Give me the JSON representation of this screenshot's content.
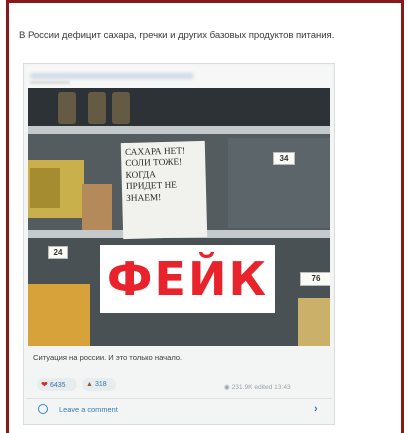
{
  "article": {
    "headline": "В России дефицит сахара, гречки и других базовых продуктов питания."
  },
  "post": {
    "sign_lines": [
      "САХАРА НЕТ!",
      "СОЛИ ТОЖЕ!",
      "КОГДА",
      "ПРИДЕТ НЕ",
      "ЗНАЕМ!"
    ],
    "price_tags": [
      "34",
      "24",
      "76"
    ],
    "stamp": "ФЕЙК",
    "caption": "Ситуация на россии. И это только начало.",
    "reactions": [
      {
        "icon": "heart-icon",
        "count": "6435"
      },
      {
        "icon": "poop-emoji-icon",
        "count": "318"
      }
    ],
    "views": "231.9K",
    "edited": "edited 13:43",
    "comment_label": "Leave a comment"
  },
  "colors": {
    "frame_border": "#8a1a1a",
    "stamp_red": "#e8232b",
    "link_blue": "#2f7dbd"
  }
}
